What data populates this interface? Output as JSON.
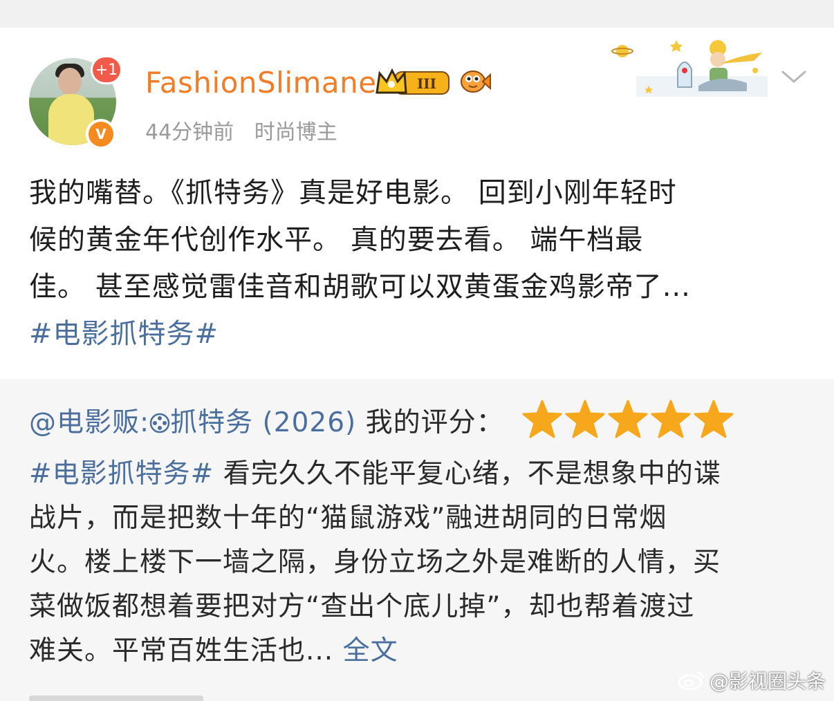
{
  "user": {
    "name": "FashionSlimane",
    "badge_plus": "+1",
    "verified_mark": "V",
    "level": "III",
    "time": "44分钟前",
    "tag": "时尚博主"
  },
  "post": {
    "lines": [
      "我的嘴替。《抓特务》真是好电影。 回到小刚年轻时",
      "候的黄金年代创作水平。 真的要去看。 端午档最",
      "佳。 甚至感觉雷佳音和胡歌可以双黄蛋金鸡影帝了..."
    ],
    "hashtag": "#电影抓特务#"
  },
  "repost": {
    "source": "@电影贩:",
    "movie": "抓特务 (2026)",
    "rating_label": " 我的评分：",
    "rating": 5,
    "hashtag": "#电影抓特务#",
    "lines": [
      " 看完久久不能平复心绪，不是想象中的谍",
      "战片，而是把数十年的“猫鼠游戏”融进胡同的日常烟",
      "火。楼上楼下一墙之隔，身份立场之外是难断的人情，买",
      "菜做饭都想着要把对方“查出个底儿掉”，却也帮着渡过",
      "难关。平常百姓生活也... "
    ],
    "full_text": "全文"
  },
  "watermark": "@影视圈头条",
  "colors": {
    "username": "#f37d26",
    "link": "#4a6f9f",
    "star": "#f7a71b"
  }
}
